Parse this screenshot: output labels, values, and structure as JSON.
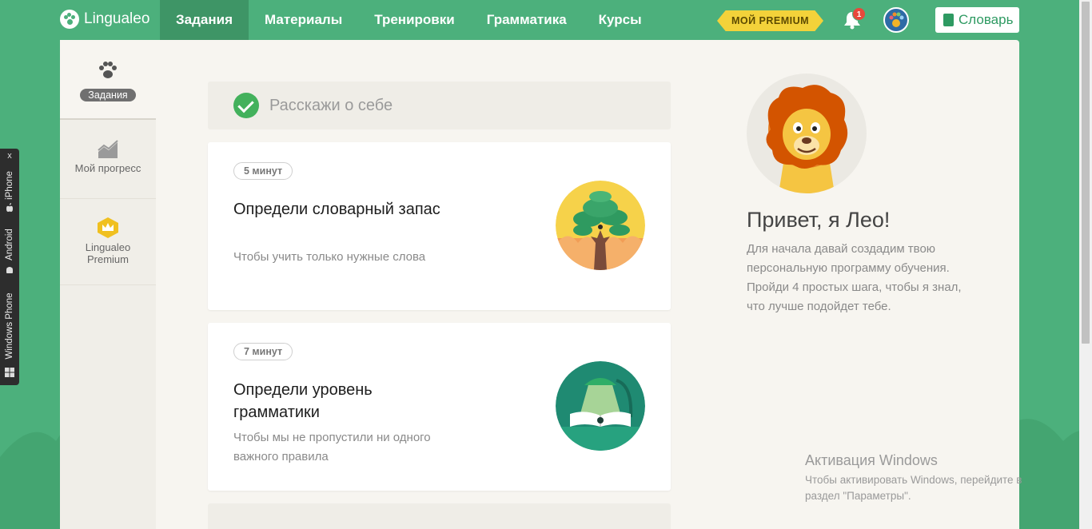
{
  "brand": {
    "name": "Lingualeo"
  },
  "nav": {
    "items": [
      {
        "label": "Задания"
      },
      {
        "label": "Материалы"
      },
      {
        "label": "Тренировки"
      },
      {
        "label": "Грамматика"
      },
      {
        "label": "Курсы"
      }
    ],
    "active_index": 0
  },
  "header": {
    "premium_label": "МОЙ PREMIUM",
    "notifications_count": "1",
    "dictionary_label": "Словарь"
  },
  "sidebar": {
    "items": [
      {
        "label": "Задания"
      },
      {
        "label": "Мой прогресс"
      },
      {
        "label": "Lingualeo Premium"
      }
    ]
  },
  "tasks": {
    "completed": {
      "title": "Расскажи о себе"
    },
    "items": [
      {
        "time": "5 минут",
        "title": "Определи словарный запас",
        "description": "Чтобы учить только нужные слова"
      },
      {
        "time": "7 минут",
        "title": "Определи уровень грамматики",
        "description": "Чтобы мы не пропустили ни одного важного правила"
      }
    ]
  },
  "leo": {
    "title": "Привет, я Лео!",
    "line1": "Для начала давай создадим твою персональную программу обучения.",
    "line2": "Пройди 4 простых шага, чтобы я знал, что лучше подойдет тебе."
  },
  "apps_tab": {
    "close": "x",
    "items": [
      "iPhone",
      "Android",
      "Windows Phone"
    ]
  },
  "activation": {
    "title": "Активация Windows",
    "text": "Чтобы активировать Windows, перейдите в раздел \"Параметры\"."
  },
  "colors": {
    "brand_green": "#4cb07c",
    "nav_active": "#3e9566",
    "premium_yellow": "#f3d23a",
    "check_green": "#43b15c",
    "badge_red": "#e8483b"
  }
}
